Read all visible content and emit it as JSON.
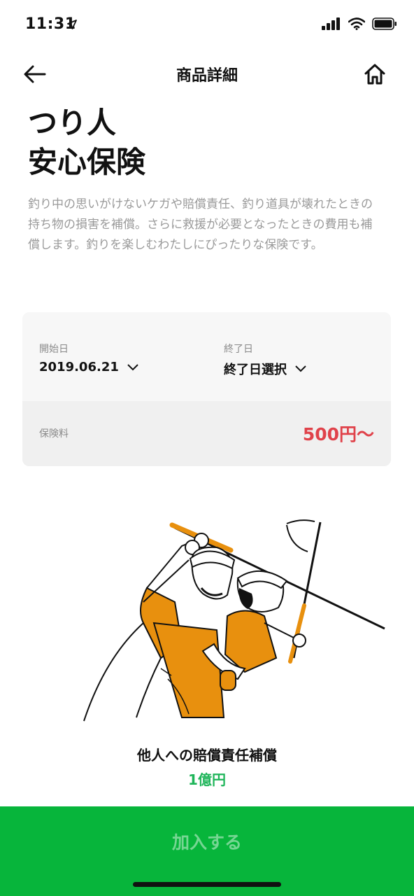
{
  "status_bar": {
    "time": "11:31"
  },
  "nav": {
    "title": "商品詳細"
  },
  "product": {
    "title_line1": "つり人",
    "title_line2": "安心保険",
    "description": "釣り中の思いがけないケガや賠償責任、釣り道具が壊れたときの持ち物の損害を補償。さらに救援が必要となったときの費用も補償します。釣りを楽しむわたしにぴったりな保険です。"
  },
  "coverage_card": {
    "start_label": "開始日",
    "start_value": "2019.06.21",
    "end_label": "終了日",
    "end_value": "終了日選択",
    "premium_label": "保険料",
    "premium_value": "500円〜"
  },
  "coverage": {
    "title": "他人への賠償責任補償",
    "amount": "1億円"
  },
  "cta": {
    "label": "加入する"
  },
  "colors": {
    "accent_green": "#07b53b",
    "price_red": "#e0424a",
    "illustration_orange": "#e8900e"
  }
}
